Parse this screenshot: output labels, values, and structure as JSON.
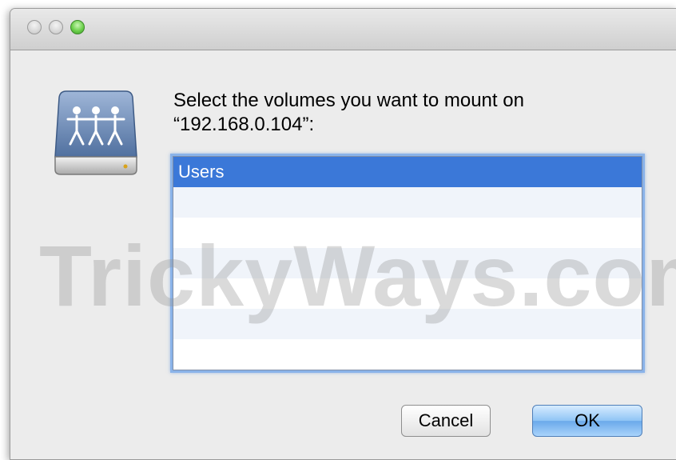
{
  "dialog": {
    "prompt_line1": "Select the volumes you want to mount on",
    "prompt_line2": "“192.168.0.104”:",
    "icon": "shared-volume-icon"
  },
  "volumes": {
    "items": [
      {
        "label": "Users",
        "selected": true
      }
    ]
  },
  "buttons": {
    "cancel_label": "Cancel",
    "ok_label": "OK"
  },
  "watermark": "TrickyWays.com",
  "colors": {
    "selection": "#3b78d8",
    "focus_ring": "#8ab3e9",
    "ok_button": "#8fc4f5",
    "zoom_button": "#6bd04a"
  }
}
